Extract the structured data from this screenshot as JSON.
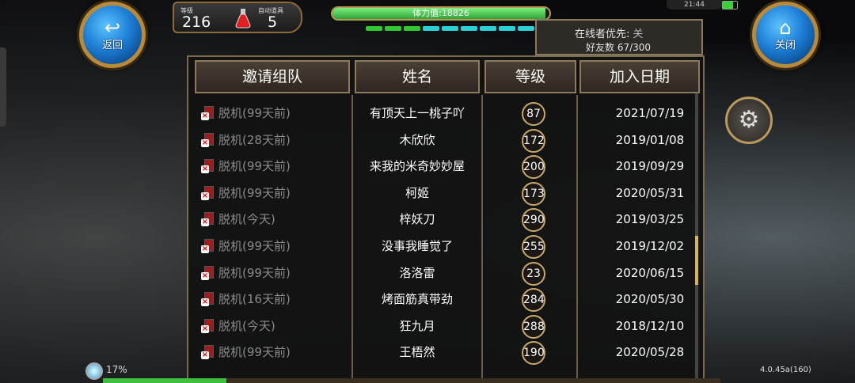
{
  "top": {
    "back_label": "返回",
    "close_label": "关闭",
    "level_label": "等级",
    "level_value": "216",
    "auto_item_label": "自动道具",
    "auto_item_value": "5",
    "stamina_text": "体力值:18826",
    "stamina_fraction": 0.98,
    "clock": "21:44",
    "zoom": "17%",
    "version": "4.0.45a(160)"
  },
  "online": {
    "priority_label": "在线者优先:",
    "priority_value": "关",
    "friends_label": "好友数",
    "friends_value": "67/300"
  },
  "table": {
    "headers": [
      "邀请组队",
      "姓名",
      "等级",
      "加入日期"
    ],
    "rows": [
      {
        "status": "脱机(99天前)",
        "name": "有顶天上一桃子吖",
        "level": "87",
        "date": "2021/07/19"
      },
      {
        "status": "脱机(28天前)",
        "name": "木欣欣",
        "level": "172",
        "date": "2019/01/08"
      },
      {
        "status": "脱机(99天前)",
        "name": "来我的米奇妙妙屋",
        "level": "200",
        "date": "2019/09/29"
      },
      {
        "status": "脱机(99天前)",
        "name": "柯姬",
        "level": "173",
        "date": "2020/05/31"
      },
      {
        "status": "脱机(今天)",
        "name": "梓妖刀",
        "level": "290",
        "date": "2019/03/25"
      },
      {
        "status": "脱机(99天前)",
        "name": "没事我睡觉了",
        "level": "255",
        "date": "2019/12/02"
      },
      {
        "status": "脱机(99天前)",
        "name": "洛洛雷",
        "level": "23",
        "date": "2020/06/15"
      },
      {
        "status": "脱机(16天前)",
        "name": "烤面筋真带劲",
        "level": "284",
        "date": "2020/05/30"
      },
      {
        "status": "脱机(今天)",
        "name": "狂九月",
        "level": "288",
        "date": "2018/12/10"
      },
      {
        "status": "脱机(99天前)",
        "name": "王梧然",
        "level": "190",
        "date": "2020/05/28"
      }
    ]
  },
  "colors": {
    "stamina_green": "#2da33a",
    "segment_green": "#32c832",
    "segment_cyan": "#2ad0d6",
    "gold": "#c7a868"
  },
  "icons": {
    "back": "back-arrow-icon",
    "close": "home-icon",
    "settings": "gear-icon",
    "potion": "potion-icon",
    "offline": "offline-device-icon"
  }
}
